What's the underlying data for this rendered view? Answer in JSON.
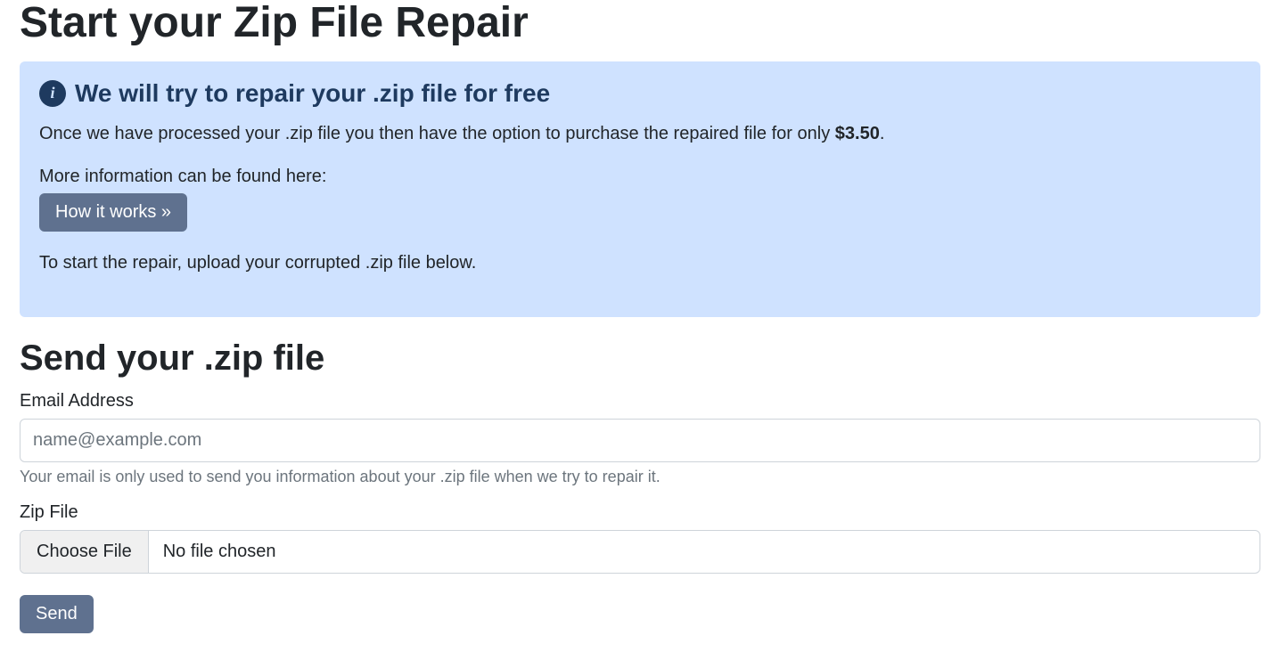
{
  "page_title": "Start your Zip File Repair",
  "alert": {
    "title": "We will try to repair your .zip file for free",
    "desc_prefix": "Once we have processed your .zip file you then have the option to purchase the repaired file for only ",
    "price": "$3.50",
    "desc_suffix": ".",
    "more_info": "More information can be found here:",
    "how_button": "How it works »",
    "instruction": "To start the repair, upload your corrupted .zip file below."
  },
  "form": {
    "heading": "Send your .zip file",
    "email_label": "Email Address",
    "email_placeholder": "name@example.com",
    "email_helper": "Your email is only used to send you information about your .zip file when we try to repair it.",
    "file_label": "Zip File",
    "choose_file": "Choose File",
    "no_file": "No file chosen",
    "send": "Send"
  }
}
